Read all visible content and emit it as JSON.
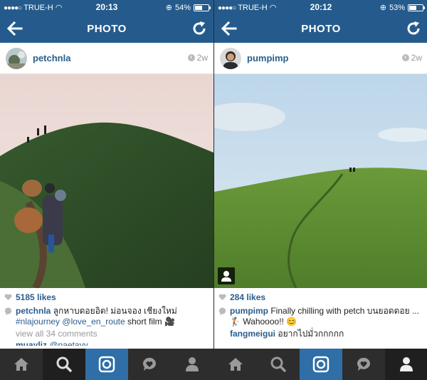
{
  "colors": {
    "accent": "#255b8c",
    "link": "#2a5d8e",
    "tab_active": "#2f6ea6",
    "tab_bar": "#2d2d2d"
  },
  "phones": [
    {
      "status": {
        "carrier": "TRUE-H",
        "time": "20:13",
        "battery": "54%",
        "battery_level": 0.54
      },
      "nav": {
        "title": "PHOTO",
        "back_icon": "back-arrow-icon",
        "refresh_icon": "refresh-icon"
      },
      "post": {
        "username": "petchnla",
        "time": "2w",
        "likes": "5185 likes",
        "caption_user": "petchnla",
        "caption_text": "ลูกหาบดอยอิต! ม่อนจอง เชียงใหม่",
        "caption_tag1": "#nlajourney",
        "caption_tag2": "@love_en_route",
        "caption_tail": "short film",
        "caption_emoji": "🎥",
        "view_all": "view all 34 comments",
        "comment_user": "muayliz",
        "comment_text": "@paetayy"
      },
      "tabs": [
        "home-icon",
        "search-icon",
        "camera-icon",
        "activity-icon",
        "profile-icon"
      ],
      "active_tab": 2
    },
    {
      "status": {
        "carrier": "TRUE-H",
        "time": "20:12",
        "battery": "53%",
        "battery_level": 0.53
      },
      "nav": {
        "title": "PHOTO",
        "back_icon": "back-arrow-icon",
        "refresh_icon": "refresh-icon"
      },
      "post": {
        "username": "pumpimp",
        "time": "2w",
        "likes": "284 likes",
        "caption_user": "pumpimp",
        "caption_text": "Finally chilling with petch บนยอดดอย ...🏌 Wahoooo!! 😊",
        "comment_user": "fangmeigui",
        "comment_text": "อยากไปมั่วกกกกก"
      },
      "tabs": [
        "home-icon",
        "search-icon",
        "camera-icon",
        "activity-icon",
        "profile-icon"
      ],
      "active_tab": 2
    }
  ]
}
